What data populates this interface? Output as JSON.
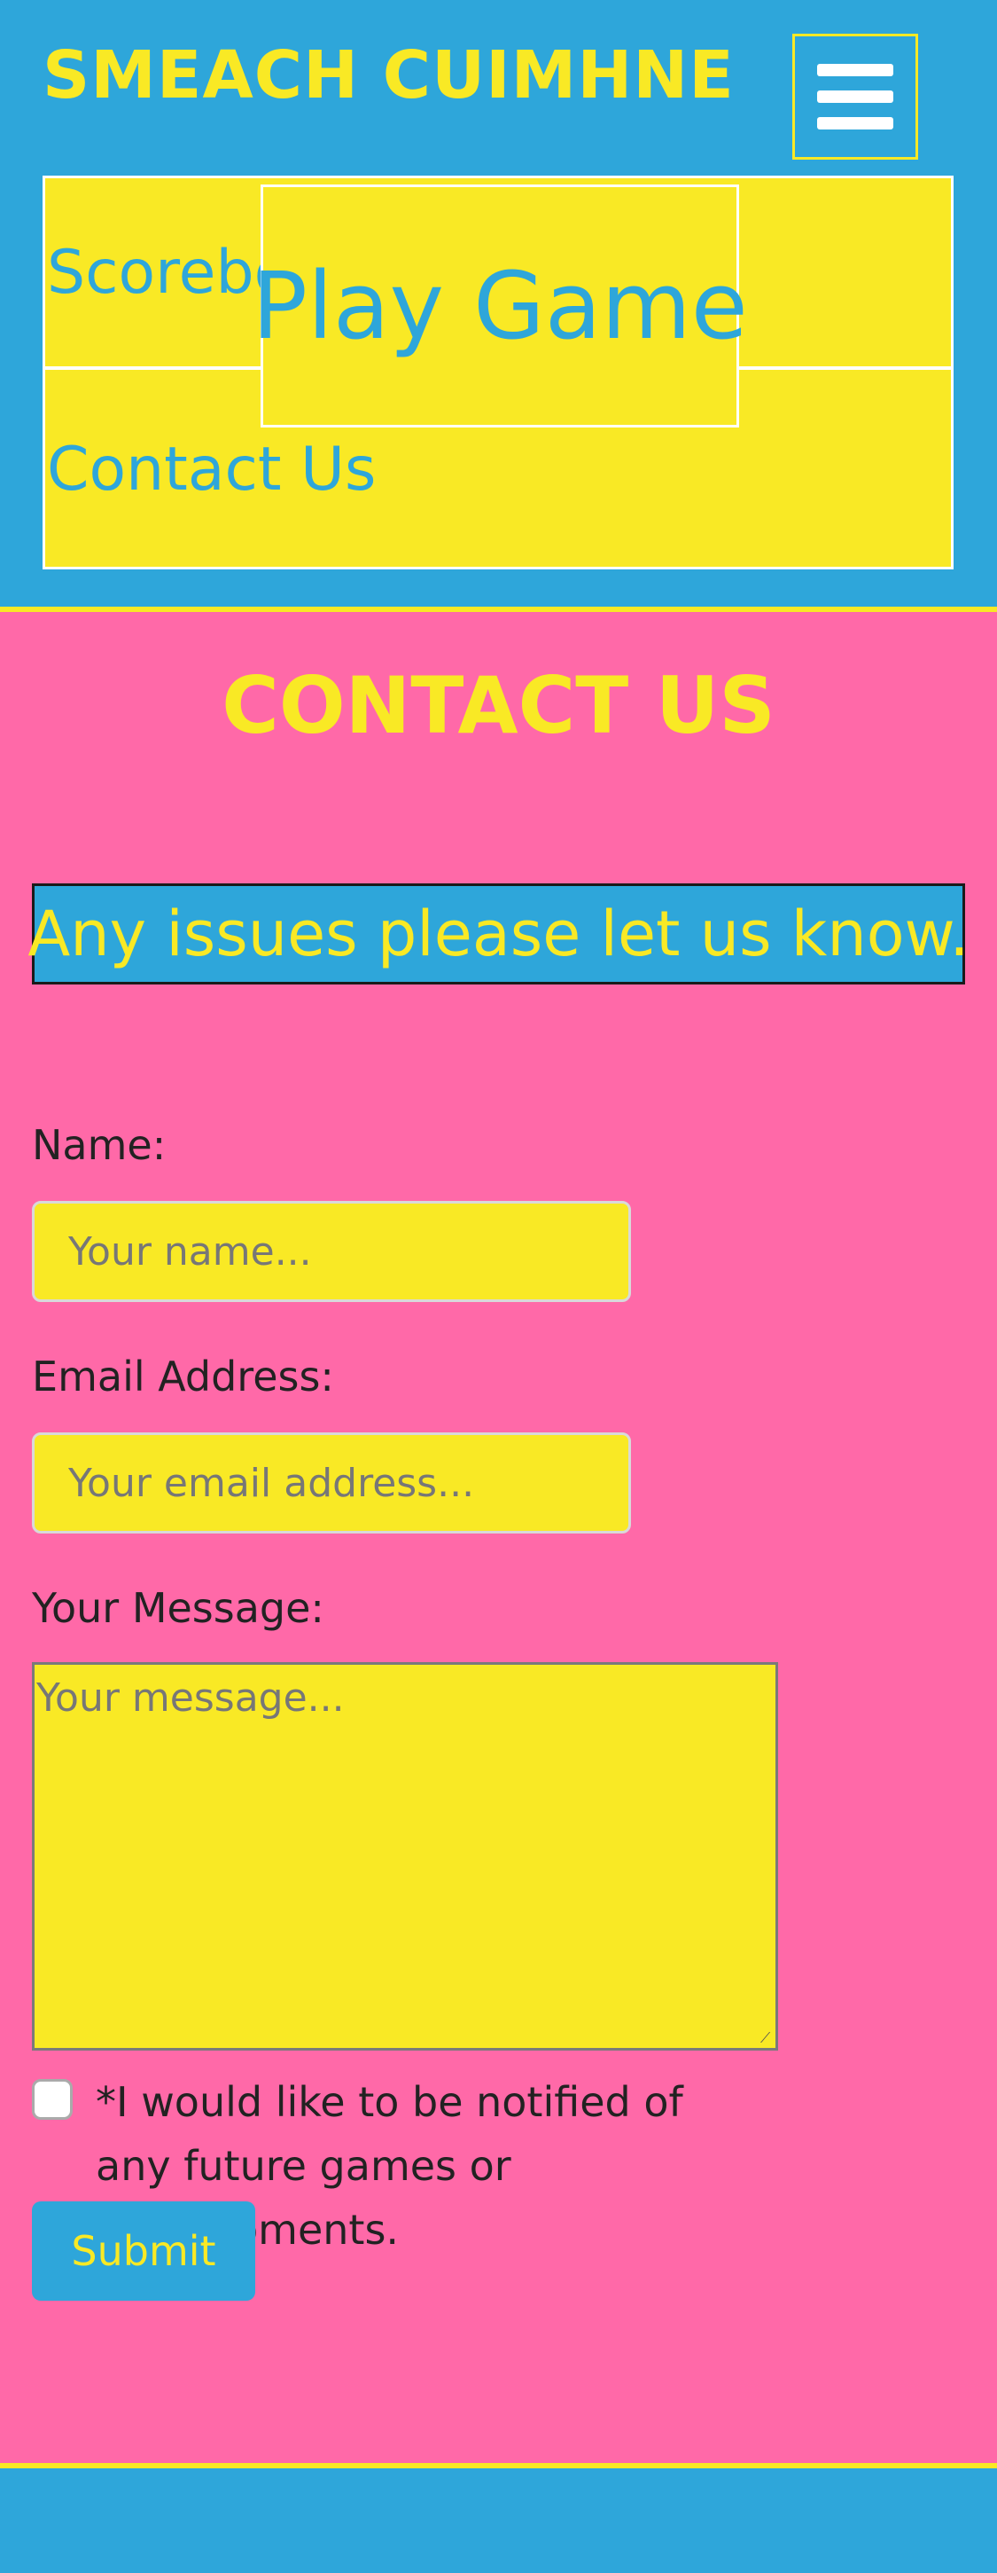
{
  "header": {
    "brand": "SMEACH CUIMHNE",
    "menu_button_icon": "hamburger-menu-icon"
  },
  "menu": {
    "items": [
      {
        "label": "Scoreboard"
      },
      {
        "label": "Contact Us"
      }
    ],
    "overlay_item": "Play Game"
  },
  "page": {
    "title": "CONTACT US",
    "notice": "Any issues please let us know."
  },
  "form": {
    "name_label": "Name:",
    "name_placeholder": "Your name...",
    "email_label": "Email Address:",
    "email_placeholder": "Your email address...",
    "message_label": "Your Message:",
    "message_placeholder": "Your message...",
    "notify_label": "*I would like to be notified of any future games or developments.",
    "notify_checked": false,
    "submit_label": "Submit"
  },
  "colors": {
    "blue": "#2ea6da",
    "yellow": "#f9e925",
    "pink": "#ff69a8"
  }
}
